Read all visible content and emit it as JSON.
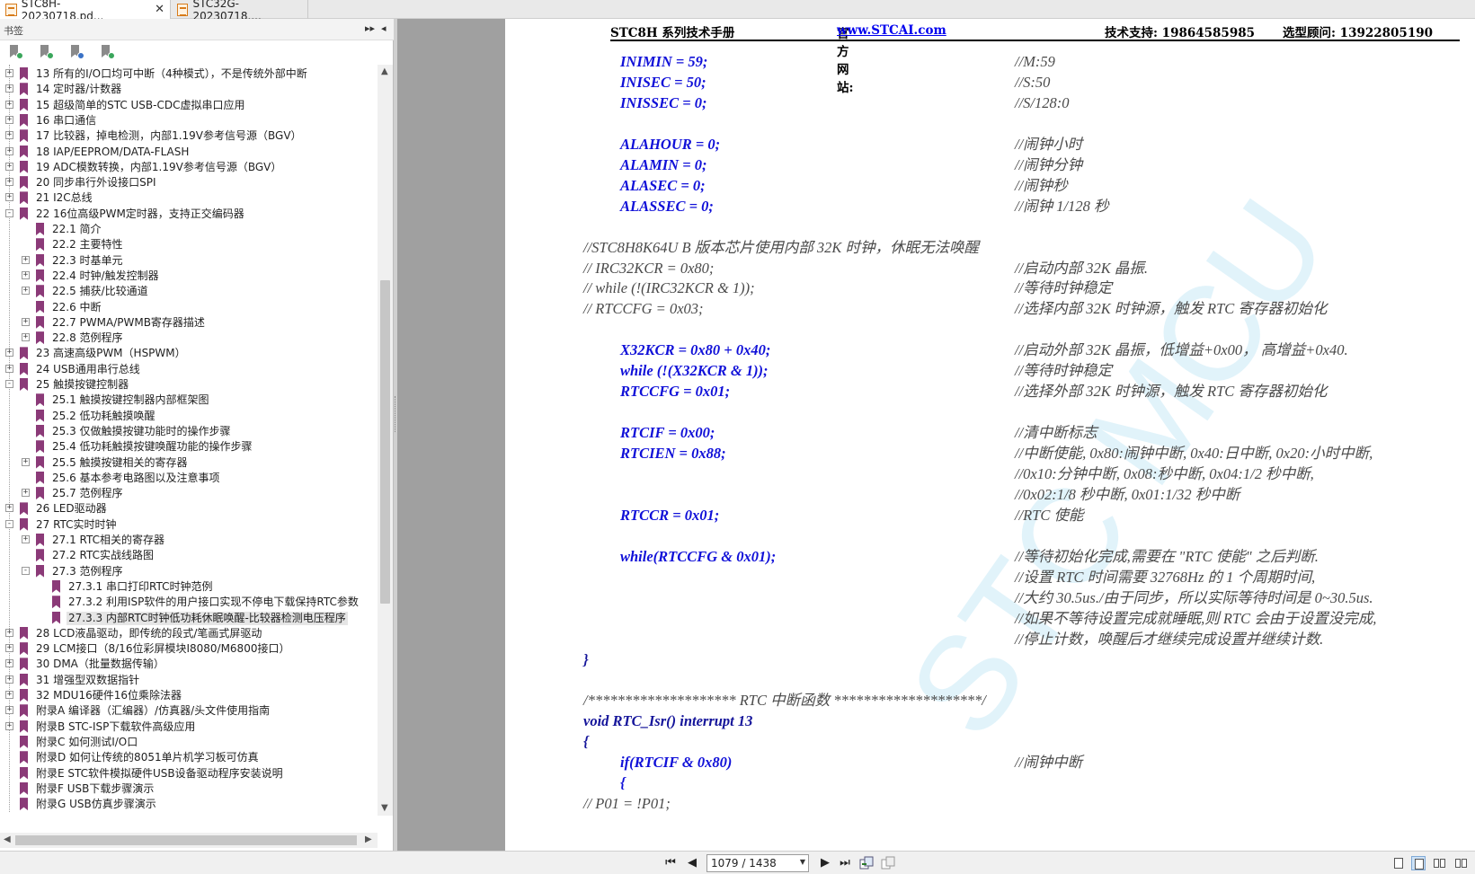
{
  "tabs": [
    {
      "label": "STC8H-20230718.pd...",
      "close": "✕"
    },
    {
      "label": "STC32G-20230718...."
    }
  ],
  "sidebar": {
    "title": "书签",
    "header_buttons": [
      "▸▸",
      "◂"
    ],
    "tools": [
      "bookmark-expand-icon",
      "bookmark-collapse-icon",
      "bookmark-add-icon",
      "bookmark-find-icon"
    ],
    "items": [
      {
        "label": "13 所有的I/O口均可中断（4种模式），不是传统外部中断",
        "level": 0,
        "exp": "+"
      },
      {
        "label": "14 定时器/计数器",
        "level": 0,
        "exp": "+"
      },
      {
        "label": "15 超级简单的STC USB-CDC虚拟串口应用",
        "level": 0,
        "exp": "+"
      },
      {
        "label": "16 串口通信",
        "level": 0,
        "exp": "+"
      },
      {
        "label": "17 比较器，掉电检测，内部1.19V参考信号源（BGV）",
        "level": 0,
        "exp": "+"
      },
      {
        "label": "18 IAP/EEPROM/DATA-FLASH",
        "level": 0,
        "exp": "+"
      },
      {
        "label": "19 ADC模数转换，内部1.19V参考信号源（BGV）",
        "level": 0,
        "exp": "+"
      },
      {
        "label": "20 同步串行外设接口SPI",
        "level": 0,
        "exp": "+"
      },
      {
        "label": "21 I2C总线",
        "level": 0,
        "exp": "+"
      },
      {
        "label": "22 16位高级PWM定时器，支持正交编码器",
        "level": 0,
        "exp": "-"
      },
      {
        "label": "22.1 简介",
        "level": 1,
        "exp": ""
      },
      {
        "label": "22.2 主要特性",
        "level": 1,
        "exp": ""
      },
      {
        "label": "22.3 时基单元",
        "level": 1,
        "exp": "+"
      },
      {
        "label": "22.4 时钟/触发控制器",
        "level": 1,
        "exp": "+"
      },
      {
        "label": "22.5 捕获/比较通道",
        "level": 1,
        "exp": "+"
      },
      {
        "label": "22.6 中断",
        "level": 1,
        "exp": ""
      },
      {
        "label": "22.7 PWMA/PWMB寄存器描述",
        "level": 1,
        "exp": "+"
      },
      {
        "label": "22.8 范例程序",
        "level": 1,
        "exp": "+"
      },
      {
        "label": "23 高速高级PWM（HSPWM）",
        "level": 0,
        "exp": "+"
      },
      {
        "label": "24 USB通用串行总线",
        "level": 0,
        "exp": "+"
      },
      {
        "label": "25 触摸按键控制器",
        "level": 0,
        "exp": "-"
      },
      {
        "label": "25.1 触摸按键控制器内部框架图",
        "level": 1,
        "exp": ""
      },
      {
        "label": "25.2 低功耗触摸唤醒",
        "level": 1,
        "exp": ""
      },
      {
        "label": "25.3 仅做触摸按键功能时的操作步骤",
        "level": 1,
        "exp": ""
      },
      {
        "label": "25.4 低功耗触摸按键唤醒功能的操作步骤",
        "level": 1,
        "exp": ""
      },
      {
        "label": "25.5 触摸按键相关的寄存器",
        "level": 1,
        "exp": "+"
      },
      {
        "label": "25.6 基本参考电路图以及注意事项",
        "level": 1,
        "exp": ""
      },
      {
        "label": "25.7  范例程序",
        "level": 1,
        "exp": "+"
      },
      {
        "label": "26 LED驱动器",
        "level": 0,
        "exp": "+"
      },
      {
        "label": "27 RTC实时时钟",
        "level": 0,
        "exp": "-"
      },
      {
        "label": "27.1 RTC相关的寄存器",
        "level": 1,
        "exp": "+"
      },
      {
        "label": "27.2 RTC实战线路图",
        "level": 1,
        "exp": ""
      },
      {
        "label": "27.3 范例程序",
        "level": 1,
        "exp": "-"
      },
      {
        "label": "27.3.1 串口打印RTC时钟范例",
        "level": 2,
        "exp": ""
      },
      {
        "label": "27.3.2 利用ISP软件的用户接口实现不停电下载保持RTC参数",
        "level": 2,
        "exp": ""
      },
      {
        "label": "27.3.3 内部RTC时钟低功耗休眠唤醒-比较器检测电压程序",
        "level": 2,
        "exp": "",
        "selected": true
      },
      {
        "label": "28 LCD液晶驱动，即传统的段式/笔画式屏驱动",
        "level": 0,
        "exp": "+"
      },
      {
        "label": "29 LCM接口（8/16位彩屏模块I8080/M6800接口）",
        "level": 0,
        "exp": "+"
      },
      {
        "label": "30 DMA（批量数据传输）",
        "level": 0,
        "exp": "+"
      },
      {
        "label": "31 增强型双数据指针",
        "level": 0,
        "exp": "+"
      },
      {
        "label": "32 MDU16硬件16位乘除法器",
        "level": 0,
        "exp": "+"
      },
      {
        "label": "附录A 编译器（汇编器）/仿真器/头文件使用指南",
        "level": 0,
        "exp": "+"
      },
      {
        "label": "附录B STC-ISP下载软件高级应用",
        "level": 0,
        "exp": "+"
      },
      {
        "label": "附录C 如何测试I/O口",
        "level": 0,
        "exp": ""
      },
      {
        "label": "附录D 如何让传统的8051单片机学习板可仿真",
        "level": 0,
        "exp": ""
      },
      {
        "label": "附录E STC软件模拟硬件USB设备驱动程序安装说明",
        "level": 0,
        "exp": ""
      },
      {
        "label": "附录F USB下载步骤演示",
        "level": 0,
        "exp": ""
      },
      {
        "label": "附录G USB仿真步骤演示",
        "level": 0,
        "exp": ""
      }
    ]
  },
  "page_header": {
    "manual": "STC8H 系列技术手册",
    "website_label": "官方网站: ",
    "website": "www.STCAI.com",
    "support": "技术支持: 19864585985",
    "advisor": "选型顾问: 13922805190"
  },
  "code_lines": [
    {
      "left": "INIMIN = 59;",
      "right": "//M:59",
      "lc": "blue",
      "indent": 1
    },
    {
      "left": "INISEC = 50;",
      "right": "//S:50",
      "lc": "blue",
      "indent": 1
    },
    {
      "left": "INISSEC = 0;",
      "right": "//S/128:0",
      "lc": "blue",
      "indent": 1
    },
    {
      "left": "",
      "right": "",
      "lc": "blue",
      "indent": 1
    },
    {
      "left": "ALAHOUR = 0;",
      "right": "//闹钟小时",
      "lc": "blue",
      "indent": 1
    },
    {
      "left": "ALAMIN = 0;",
      "right": "//闹钟分钟",
      "lc": "blue",
      "indent": 1
    },
    {
      "left": "ALASEC = 0;",
      "right": "//闹钟秒",
      "lc": "blue",
      "indent": 1
    },
    {
      "left": "ALASSEC = 0;",
      "right": "//闹钟 1/128 秒",
      "lc": "blue",
      "indent": 1
    },
    {
      "left": "",
      "right": "",
      "lc": "blue",
      "indent": 1
    },
    {
      "left": "//STC8H8K64U B 版本芯片使用内部 32K 时钟，休眠无法唤醒",
      "right": "",
      "lc": "grey",
      "indent": 0
    },
    {
      "left": "//        IRC32KCR = 0x80;",
      "right": "//启动内部 32K 晶振.",
      "lc": "grey",
      "indent": 0
    },
    {
      "left": "//        while (!(IRC32KCR & 1));",
      "right": "//等待时钟稳定",
      "lc": "grey",
      "indent": 0
    },
    {
      "left": "//        RTCCFG = 0x03;",
      "right": "//选择内部 32K 时钟源，触发 RTC 寄存器初始化",
      "lc": "grey",
      "indent": 0
    },
    {
      "left": "",
      "right": "",
      "lc": "blue",
      "indent": 1
    },
    {
      "left": "X32KCR = 0x80 + 0x40;",
      "right": "//启动外部 32K 晶振，低增益+0x00，  高增益+0x40.",
      "lc": "blue",
      "indent": 1
    },
    {
      "left": "while (!(X32KCR & 1));",
      "right": "//等待时钟稳定",
      "lc": "blue",
      "indent": 1
    },
    {
      "left": "RTCCFG = 0x01;",
      "right": "//选择外部 32K 时钟源，触发 RTC 寄存器初始化",
      "lc": "blue",
      "indent": 1
    },
    {
      "left": "",
      "right": "",
      "lc": "blue",
      "indent": 1
    },
    {
      "left": "RTCIF = 0x00;",
      "right": "//清中断标志",
      "lc": "blue",
      "indent": 1
    },
    {
      "left": "RTCIEN = 0x88;",
      "right": "//中断使能, 0x80:闹钟中断, 0x40:日中断, 0x20:小时中断,",
      "lc": "blue",
      "indent": 1
    },
    {
      "left": "",
      "right": "//0x10:分钟中断, 0x08:秒中断, 0x04:1/2 秒中断,",
      "lc": "blue",
      "indent": 1
    },
    {
      "left": "",
      "right": "//0x02:1/8 秒中断, 0x01:1/32 秒中断",
      "lc": "blue",
      "indent": 1
    },
    {
      "left": "RTCCR = 0x01;",
      "right": "//RTC 使能",
      "lc": "blue",
      "indent": 1
    },
    {
      "left": "",
      "right": "",
      "lc": "blue",
      "indent": 1
    },
    {
      "left": "while(RTCCFG & 0x01);",
      "right": "//等待初始化完成,需要在 \"RTC 使能\" 之后判断.",
      "lc": "blue",
      "indent": 1
    },
    {
      "left": "",
      "right": "//设置 RTC 时间需要 32768Hz 的 1 个周期时间,",
      "lc": "blue",
      "indent": 1
    },
    {
      "left": "",
      "right": "//大约 30.5us./由于同步，所以实际等待时间是 0~30.5us.",
      "lc": "blue",
      "indent": 1
    },
    {
      "left": "",
      "right": "//如果不等待设置完成就睡眠,则 RTC 会由于设置没完成,",
      "lc": "blue",
      "indent": 1
    },
    {
      "left": "",
      "right": "//停止计数，唤醒后才继续完成设置并继续计数.",
      "lc": "blue",
      "indent": 1
    },
    {
      "left": "}",
      "right": "",
      "lc": "navy",
      "indent": 0
    },
    {
      "left": "",
      "right": "",
      "lc": "blue",
      "indent": 0
    },
    {
      "left": "/******************** RTC 中断函数  ********************/",
      "right": "",
      "lc": "grey",
      "indent": 0
    },
    {
      "left": "void RTC_Isr() interrupt 13",
      "right": "",
      "lc": "navy",
      "indent": 0
    },
    {
      "left": "{",
      "right": "",
      "lc": "navy",
      "indent": 0
    },
    {
      "left": "if(RTCIF & 0x80)",
      "right": "//闹钟中断",
      "lc": "blue",
      "indent": 1
    },
    {
      "left": "{",
      "right": "",
      "lc": "blue",
      "indent": 1
    },
    {
      "left": "//                P01 = !P01;",
      "right": "",
      "lc": "grey",
      "indent": 0
    }
  ],
  "watermark": "STC MCU",
  "bottom": {
    "page_value": "1079 / 1438",
    "nav": [
      "first-page-icon",
      "prev-page-icon",
      "next-page-icon",
      "last-page-icon"
    ]
  }
}
